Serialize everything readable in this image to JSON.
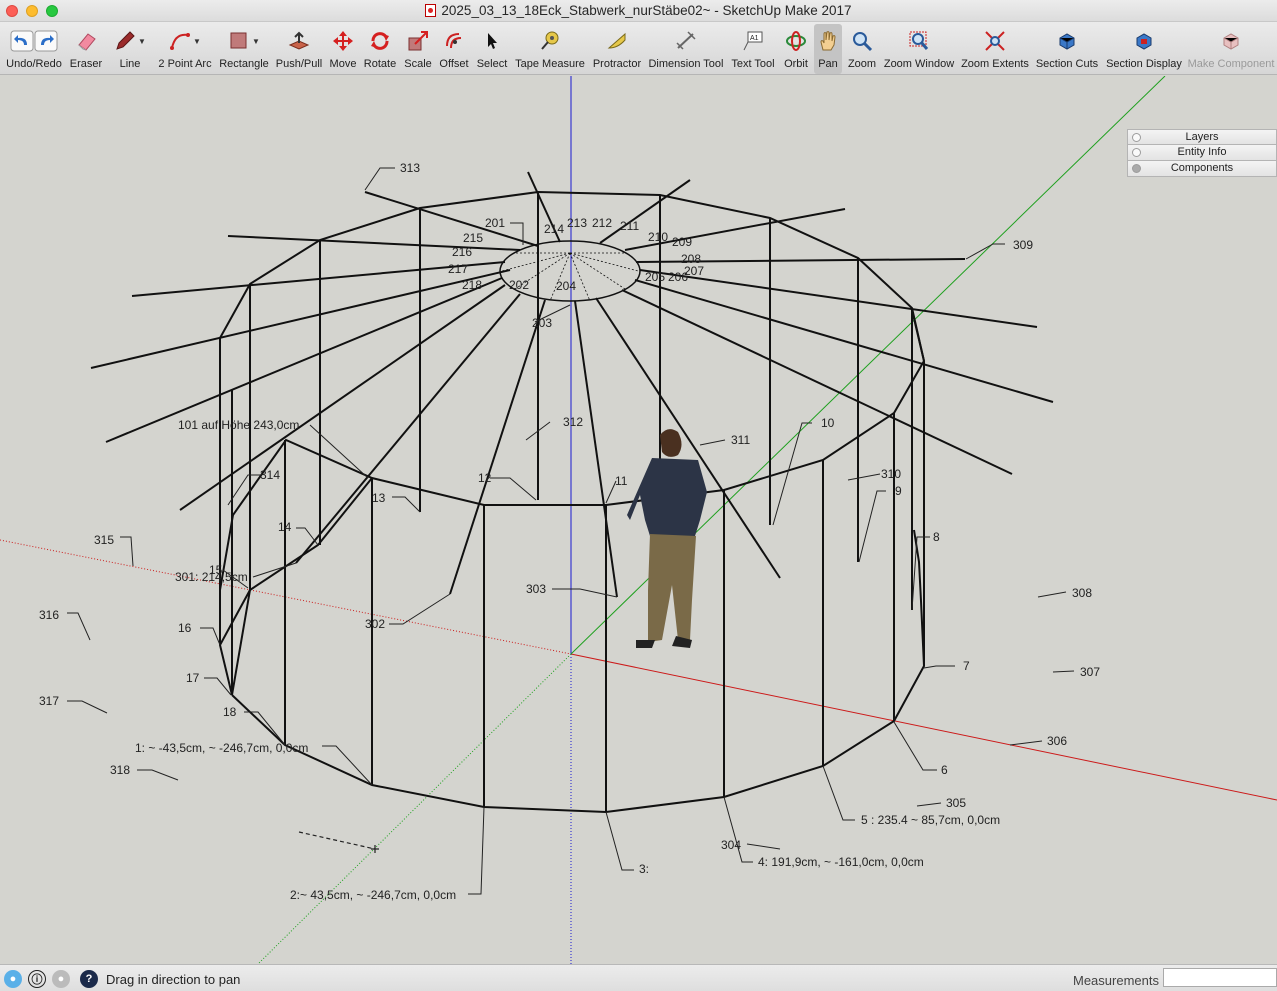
{
  "window": {
    "title": "2025_03_13_18Eck_Stabwerk_nurStäbe02~ - SketchUp Make 2017"
  },
  "toolbar": {
    "tools": [
      {
        "id": "undo-redo",
        "label": "Undo/Redo"
      },
      {
        "id": "eraser",
        "label": "Eraser"
      },
      {
        "id": "line",
        "label": "Line"
      },
      {
        "id": "arc",
        "label": "2 Point Arc"
      },
      {
        "id": "rectangle",
        "label": "Rectangle"
      },
      {
        "id": "push-pull",
        "label": "Push/Pull"
      },
      {
        "id": "move",
        "label": "Move"
      },
      {
        "id": "rotate",
        "label": "Rotate"
      },
      {
        "id": "scale",
        "label": "Scale"
      },
      {
        "id": "offset",
        "label": "Offset"
      },
      {
        "id": "select",
        "label": "Select"
      },
      {
        "id": "tape",
        "label": "Tape Measure"
      },
      {
        "id": "protractor",
        "label": "Protractor"
      },
      {
        "id": "dimension",
        "label": "Dimension Tool"
      },
      {
        "id": "text",
        "label": "Text Tool"
      },
      {
        "id": "orbit",
        "label": "Orbit"
      },
      {
        "id": "pan",
        "label": "Pan"
      },
      {
        "id": "zoom",
        "label": "Zoom"
      },
      {
        "id": "zoom-window",
        "label": "Zoom Window"
      },
      {
        "id": "zoom-extents",
        "label": "Zoom Extents"
      },
      {
        "id": "section-cuts",
        "label": "Section Cuts"
      },
      {
        "id": "section-display",
        "label": "Section Display"
      },
      {
        "id": "make-component",
        "label": "Make Component"
      }
    ],
    "active_tool": "Pan"
  },
  "trays": [
    "Layers",
    "Entity Info",
    "Components"
  ],
  "model_labels": {
    "n313": "313",
    "n201": "201",
    "n213": "213",
    "n212": "212",
    "n211": "211",
    "n214": "214",
    "n215": "215",
    "n216": "216",
    "n217": "217",
    "n218": "218",
    "n202": "202",
    "n204": "204",
    "n203": "203",
    "n210": "210",
    "n209": "209",
    "n208": "208",
    "n207": "207",
    "n206": "206",
    "n205": "205",
    "n309": "309",
    "n101": "101 auf Höhe 243,0cm",
    "n312": "312",
    "n311": "311",
    "n10": "10",
    "n314": "314",
    "n12": "12",
    "n11": "11",
    "n310": "310",
    "n9": "9",
    "n13": "13",
    "n14": "14",
    "n8": "8",
    "n315": "315",
    "n15": "15",
    "n301": "301: 214,5cm",
    "n303": "303",
    "n308": "308",
    "n316": "316",
    "n16": "16",
    "n302": "302",
    "n7": "7",
    "n307": "307",
    "n17": "17",
    "n317": "317",
    "n18": "18",
    "n306": "306",
    "n1": "1: ~ -43,5cm, ~ -246,7cm, 0,0cm",
    "n6": "6",
    "n318": "318",
    "n305": "305",
    "n5": "5 : 235.4 ~ 85,7cm, 0,0cm",
    "n304": "304",
    "n4": "4: 191,9cm, ~ -161,0cm, 0,0cm",
    "n3": "3:",
    "n2": "2:~ 43,5cm, ~ -246,7cm, 0,0cm"
  },
  "status": {
    "hint": "Drag in direction to pan",
    "measurements_label": "Measurements",
    "measurements_value": ""
  }
}
